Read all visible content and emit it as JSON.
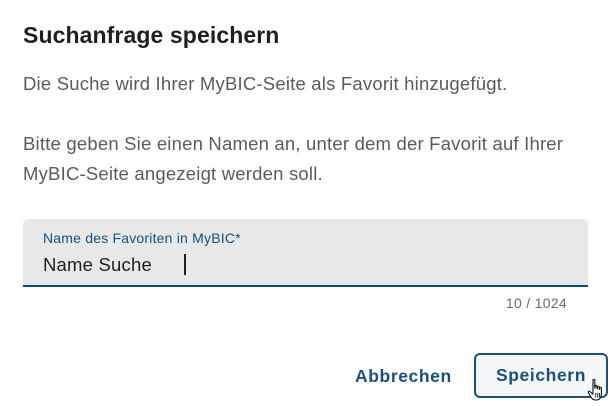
{
  "dialog": {
    "title": "Suchanfrage speichern",
    "intro": "Die Suche wird Ihrer MyBIC-Seite als Favorit hinzugefügt.",
    "instruction": "Bitte geben Sie einen Namen an, unter dem der Favorit auf Ihrer MyBIC-Seite angezeigt werden soll."
  },
  "name_field": {
    "label": "Name des Favoriten in MyBIC*",
    "value": "Name Suche",
    "counter": "10 / 1024"
  },
  "actions": {
    "cancel_label": "Abbrechen",
    "save_label": "Speichern"
  },
  "colors": {
    "accent": "#1a4f7e",
    "field_background": "#e8e8e8",
    "text_primary": "#1f1f1f",
    "text_secondary": "#5b5b5b"
  },
  "icons": {
    "pointer": "hand-pointer-cursor-icon"
  }
}
